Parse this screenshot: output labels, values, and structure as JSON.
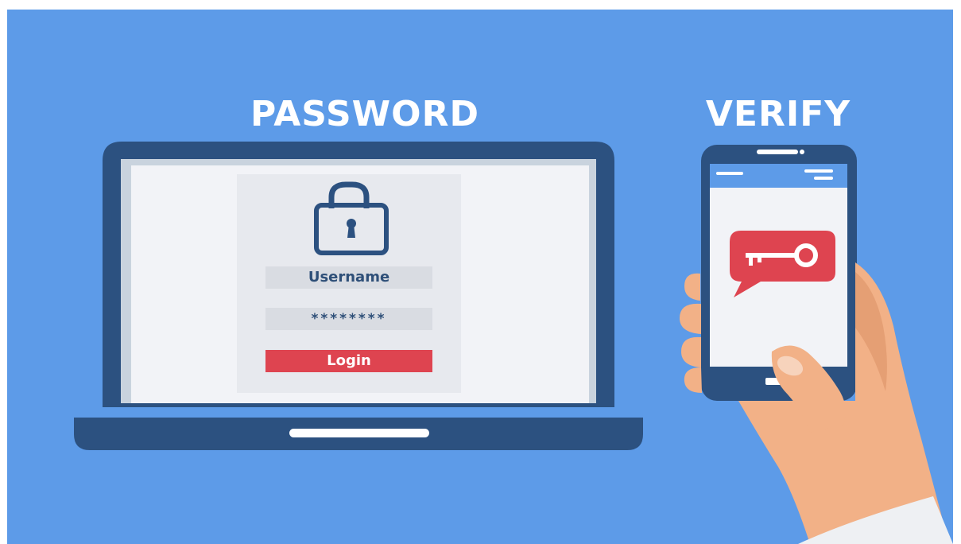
{
  "labels": {
    "password_heading": "PASSWORD",
    "verify_heading": "VERIFY"
  },
  "login_form": {
    "username_label": "Username",
    "password_mask": "********",
    "login_label": "Login"
  },
  "icons": {
    "laptop": "laptop-icon",
    "padlock": "padlock-icon",
    "phone": "smartphone-icon",
    "key_message": "key-message-icon",
    "hand": "hand-illustration"
  },
  "colors": {
    "background": "#5d9be8",
    "device_frame": "#2c5180",
    "screen": "#f2f3f7",
    "form_panel": "#e7e9ee",
    "field": "#d9dce2",
    "accent_red": "#de4450",
    "skin": "#f2b187",
    "skin_shade": "#e59f74",
    "sleeve": "#eef0f3"
  }
}
